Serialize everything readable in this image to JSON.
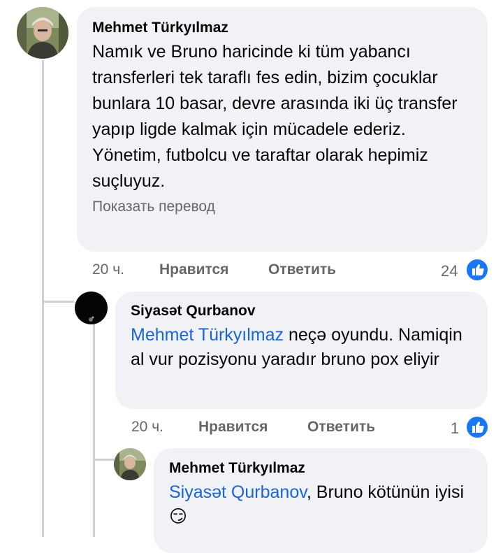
{
  "comments": [
    {
      "author": "Mehmet Türkyılmaz",
      "text": "Namık ve Bruno haricinde ki tüm yabancı transferleri tek taraflı fes edin, bizim çocuklar bunlara 10 basar,  devre arasında iki üç transfer yapıp ligde kalmak için mücadele ederiz. Yönetim, futbolcu ve taraftar olarak hepimiz suçluyuz.",
      "translate": "Показать перевод",
      "time": "20 ч.",
      "like": "Нравится",
      "reply": "Ответить",
      "reactions": "24"
    },
    {
      "author": "Siyasət Qurbanov",
      "mention": "Mehmet Türkyılmaz",
      "text": " neçə oyundu. Namiqin al vur  pozisyonu yaradır bruno pox eliyir",
      "time": "20 ч.",
      "like": "Нравится",
      "reply": "Ответить",
      "reactions": "1"
    },
    {
      "author": "Mehmet Türkyılmaz",
      "mention": "Siyasət Qurbanov",
      "text": ", Bruno kötünün iyisi 😏"
    }
  ],
  "colors": {
    "bubble": "#f0f2f5",
    "mention": "#1a64d6",
    "meta": "#65676b",
    "like_badge": "#1877f2"
  },
  "icons": [
    "avatar-photo",
    "like-icon"
  ]
}
